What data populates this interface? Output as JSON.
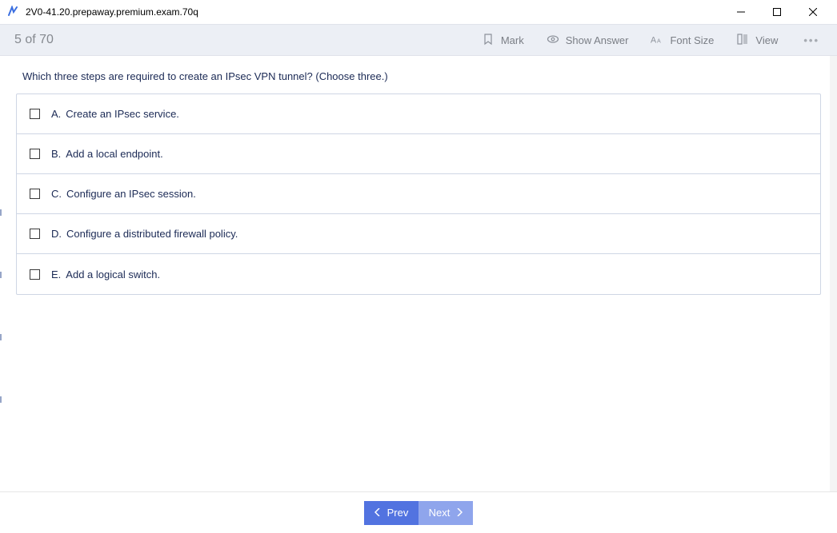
{
  "window": {
    "title": "2V0-41.20.prepaway.premium.exam.70q"
  },
  "toolbar": {
    "counter": "5 of 70",
    "mark": "Mark",
    "show_answer": "Show Answer",
    "font_size": "Font Size",
    "view": "View"
  },
  "question": "Which three steps are required to create an IPsec VPN tunnel? (Choose three.)",
  "answers": [
    {
      "letter": "A.",
      "text": "Create an IPsec service."
    },
    {
      "letter": "B.",
      "text": "Add a local endpoint."
    },
    {
      "letter": "C.",
      "text": "Configure an IPsec session."
    },
    {
      "letter": "D.",
      "text": "Configure a distributed firewall policy."
    },
    {
      "letter": "E.",
      "text": "Add a logical switch."
    }
  ],
  "footer": {
    "prev": "Prev",
    "next": "Next"
  }
}
